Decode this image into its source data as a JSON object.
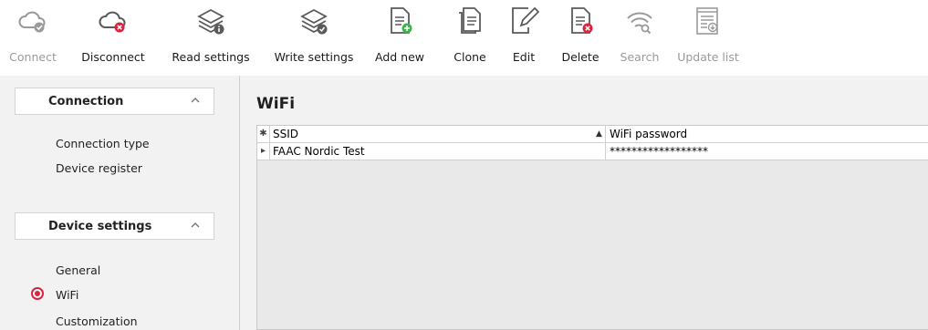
{
  "toolbar": {
    "connect": "Connect",
    "disconnect": "Disconnect",
    "read_settings": "Read settings",
    "write_settings": "Write settings",
    "add_new": "Add new",
    "clone": "Clone",
    "edit": "Edit",
    "delete": "Delete",
    "search": "Search",
    "update_list": "Update list"
  },
  "sidebar": {
    "connection": {
      "title": "Connection",
      "items": [
        "Connection type",
        "Device register"
      ]
    },
    "device_settings": {
      "title": "Device settings",
      "items": [
        "General",
        "WiFi",
        "Customization"
      ]
    }
  },
  "main": {
    "title": "WiFi",
    "grid": {
      "new_row_marker": "✱",
      "current_row_marker": "▸",
      "sort_indicator": "▲",
      "columns": [
        "SSID",
        "WiFi password"
      ],
      "rows": [
        {
          "ssid": "FAAC Nordic Test",
          "password": "******************"
        }
      ]
    }
  },
  "colors": {
    "accent_red": "#d9243d",
    "icon_gray": "#5a5a5a",
    "add_green": "#3bb54a"
  }
}
